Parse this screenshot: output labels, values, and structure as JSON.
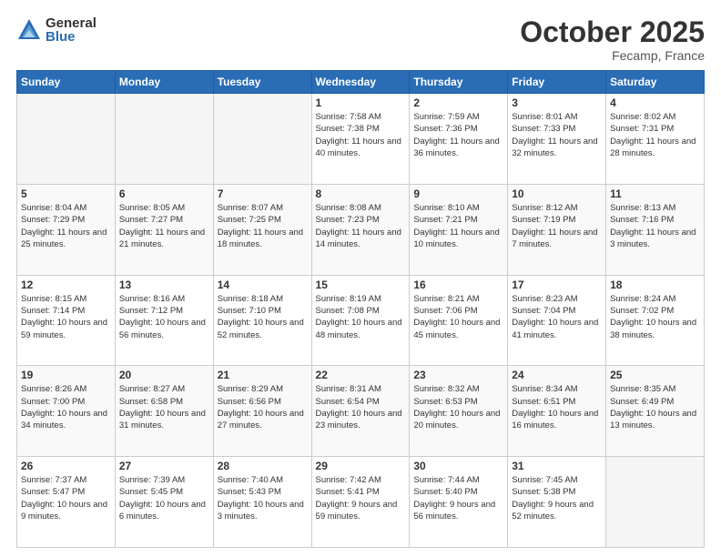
{
  "header": {
    "logo_general": "General",
    "logo_blue": "Blue",
    "month": "October 2025",
    "location": "Fecamp, France"
  },
  "weekdays": [
    "Sunday",
    "Monday",
    "Tuesday",
    "Wednesday",
    "Thursday",
    "Friday",
    "Saturday"
  ],
  "weeks": [
    [
      {
        "day": "",
        "info": ""
      },
      {
        "day": "",
        "info": ""
      },
      {
        "day": "",
        "info": ""
      },
      {
        "day": "1",
        "info": "Sunrise: 7:58 AM\nSunset: 7:38 PM\nDaylight: 11 hours\nand 40 minutes."
      },
      {
        "day": "2",
        "info": "Sunrise: 7:59 AM\nSunset: 7:36 PM\nDaylight: 11 hours\nand 36 minutes."
      },
      {
        "day": "3",
        "info": "Sunrise: 8:01 AM\nSunset: 7:33 PM\nDaylight: 11 hours\nand 32 minutes."
      },
      {
        "day": "4",
        "info": "Sunrise: 8:02 AM\nSunset: 7:31 PM\nDaylight: 11 hours\nand 28 minutes."
      }
    ],
    [
      {
        "day": "5",
        "info": "Sunrise: 8:04 AM\nSunset: 7:29 PM\nDaylight: 11 hours\nand 25 minutes."
      },
      {
        "day": "6",
        "info": "Sunrise: 8:05 AM\nSunset: 7:27 PM\nDaylight: 11 hours\nand 21 minutes."
      },
      {
        "day": "7",
        "info": "Sunrise: 8:07 AM\nSunset: 7:25 PM\nDaylight: 11 hours\nand 18 minutes."
      },
      {
        "day": "8",
        "info": "Sunrise: 8:08 AM\nSunset: 7:23 PM\nDaylight: 11 hours\nand 14 minutes."
      },
      {
        "day": "9",
        "info": "Sunrise: 8:10 AM\nSunset: 7:21 PM\nDaylight: 11 hours\nand 10 minutes."
      },
      {
        "day": "10",
        "info": "Sunrise: 8:12 AM\nSunset: 7:19 PM\nDaylight: 11 hours\nand 7 minutes."
      },
      {
        "day": "11",
        "info": "Sunrise: 8:13 AM\nSunset: 7:16 PM\nDaylight: 11 hours\nand 3 minutes."
      }
    ],
    [
      {
        "day": "12",
        "info": "Sunrise: 8:15 AM\nSunset: 7:14 PM\nDaylight: 10 hours\nand 59 minutes."
      },
      {
        "day": "13",
        "info": "Sunrise: 8:16 AM\nSunset: 7:12 PM\nDaylight: 10 hours\nand 56 minutes."
      },
      {
        "day": "14",
        "info": "Sunrise: 8:18 AM\nSunset: 7:10 PM\nDaylight: 10 hours\nand 52 minutes."
      },
      {
        "day": "15",
        "info": "Sunrise: 8:19 AM\nSunset: 7:08 PM\nDaylight: 10 hours\nand 48 minutes."
      },
      {
        "day": "16",
        "info": "Sunrise: 8:21 AM\nSunset: 7:06 PM\nDaylight: 10 hours\nand 45 minutes."
      },
      {
        "day": "17",
        "info": "Sunrise: 8:23 AM\nSunset: 7:04 PM\nDaylight: 10 hours\nand 41 minutes."
      },
      {
        "day": "18",
        "info": "Sunrise: 8:24 AM\nSunset: 7:02 PM\nDaylight: 10 hours\nand 38 minutes."
      }
    ],
    [
      {
        "day": "19",
        "info": "Sunrise: 8:26 AM\nSunset: 7:00 PM\nDaylight: 10 hours\nand 34 minutes."
      },
      {
        "day": "20",
        "info": "Sunrise: 8:27 AM\nSunset: 6:58 PM\nDaylight: 10 hours\nand 31 minutes."
      },
      {
        "day": "21",
        "info": "Sunrise: 8:29 AM\nSunset: 6:56 PM\nDaylight: 10 hours\nand 27 minutes."
      },
      {
        "day": "22",
        "info": "Sunrise: 8:31 AM\nSunset: 6:54 PM\nDaylight: 10 hours\nand 23 minutes."
      },
      {
        "day": "23",
        "info": "Sunrise: 8:32 AM\nSunset: 6:53 PM\nDaylight: 10 hours\nand 20 minutes."
      },
      {
        "day": "24",
        "info": "Sunrise: 8:34 AM\nSunset: 6:51 PM\nDaylight: 10 hours\nand 16 minutes."
      },
      {
        "day": "25",
        "info": "Sunrise: 8:35 AM\nSunset: 6:49 PM\nDaylight: 10 hours\nand 13 minutes."
      }
    ],
    [
      {
        "day": "26",
        "info": "Sunrise: 7:37 AM\nSunset: 5:47 PM\nDaylight: 10 hours\nand 9 minutes."
      },
      {
        "day": "27",
        "info": "Sunrise: 7:39 AM\nSunset: 5:45 PM\nDaylight: 10 hours\nand 6 minutes."
      },
      {
        "day": "28",
        "info": "Sunrise: 7:40 AM\nSunset: 5:43 PM\nDaylight: 10 hours\nand 3 minutes."
      },
      {
        "day": "29",
        "info": "Sunrise: 7:42 AM\nSunset: 5:41 PM\nDaylight: 9 hours\nand 59 minutes."
      },
      {
        "day": "30",
        "info": "Sunrise: 7:44 AM\nSunset: 5:40 PM\nDaylight: 9 hours\nand 56 minutes."
      },
      {
        "day": "31",
        "info": "Sunrise: 7:45 AM\nSunset: 5:38 PM\nDaylight: 9 hours\nand 52 minutes."
      },
      {
        "day": "",
        "info": ""
      }
    ]
  ]
}
